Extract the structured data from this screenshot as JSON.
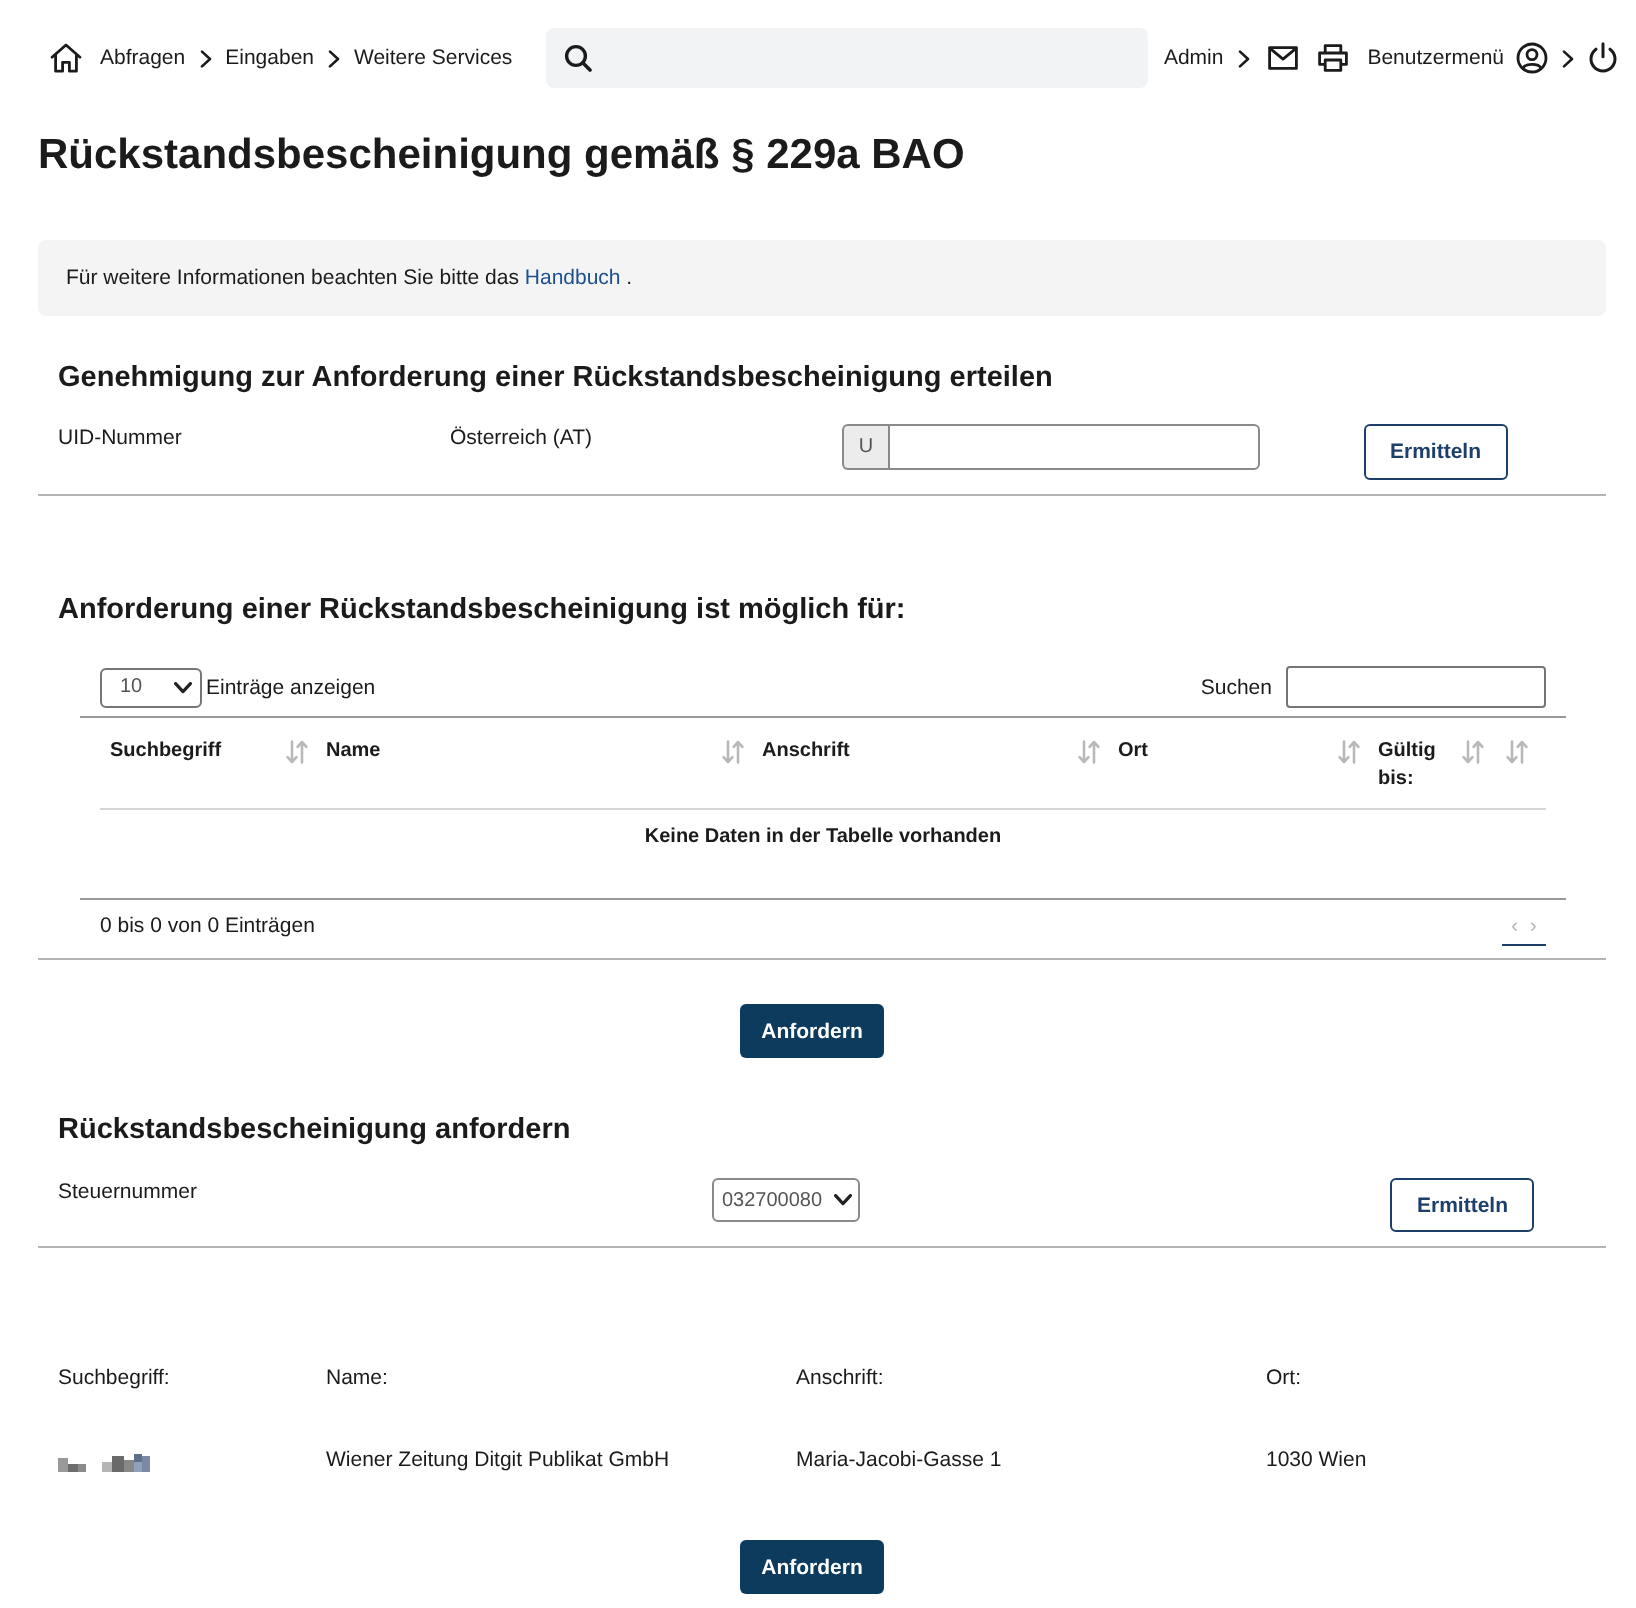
{
  "top_nav": {
    "breadcrumbs": [
      {
        "label": "Abfragen"
      },
      {
        "label": "Eingaben"
      },
      {
        "label": "Weitere Services"
      }
    ],
    "admin": "Admin",
    "user_menu": "Benutzermenü"
  },
  "page_title": "Rückstandsbescheinigung gemäß § 229a BAO",
  "info_box": {
    "text": "Für weitere Informationen beachten Sie bitte das",
    "link": "Handbuch",
    "text_after": "."
  },
  "approval_section": {
    "heading": "Genehmigung zur Anforderung einer Rückstandsbescheinigung erteilen",
    "label": "UID-Nummer",
    "country": "Österreich (AT)",
    "uid_prefix": "U",
    "button": "Ermitteln"
  },
  "eligible_section": {
    "heading": "Anforderung einer Rückstandsbescheinigung ist möglich für:",
    "page_length": "10",
    "page_length_label": "Einträge anzeigen",
    "search_label": "Suchen",
    "table": {
      "columns": [
        {
          "kind": "labeled",
          "label": "Suchbegriff"
        },
        {
          "kind": "labeled",
          "label": "Name"
        },
        {
          "kind": "labeled",
          "label": "Anschrift"
        },
        {
          "kind": "labeled",
          "label": "Ort"
        },
        {
          "kind": "labeled",
          "label": "Gültig bis:"
        },
        {
          "kind": "unlabeled"
        }
      ],
      "empty_message": "Keine Daten in der Tabelle vorhanden"
    },
    "info": "0 bis 0 von 0 Einträgen",
    "pagination": [
      {
        "label": "‹",
        "disabled": true
      },
      {
        "label": "›",
        "disabled": true
      }
    ],
    "button": "Anfordern"
  },
  "request_section": {
    "heading": "Rückstandsbescheinigung anfordern",
    "label": "Steuernummer",
    "tax_number": "032700080",
    "button": "Ermitteln"
  },
  "result": {
    "columns": [
      "Suchbegriff:",
      "Name:",
      "Anschrift:",
      "Ort:"
    ],
    "rows": [
      {
        "cells": [
          {
            "kind": "redacted"
          },
          {
            "kind": "text",
            "text": "Wiener Zeitung Ditgit Publikat GmbH"
          },
          {
            "kind": "text",
            "text": "Maria-Jacobi-Gasse 1"
          },
          {
            "kind": "text",
            "text": "1030 Wien"
          }
        ]
      }
    ],
    "button": "Anfordern"
  }
}
